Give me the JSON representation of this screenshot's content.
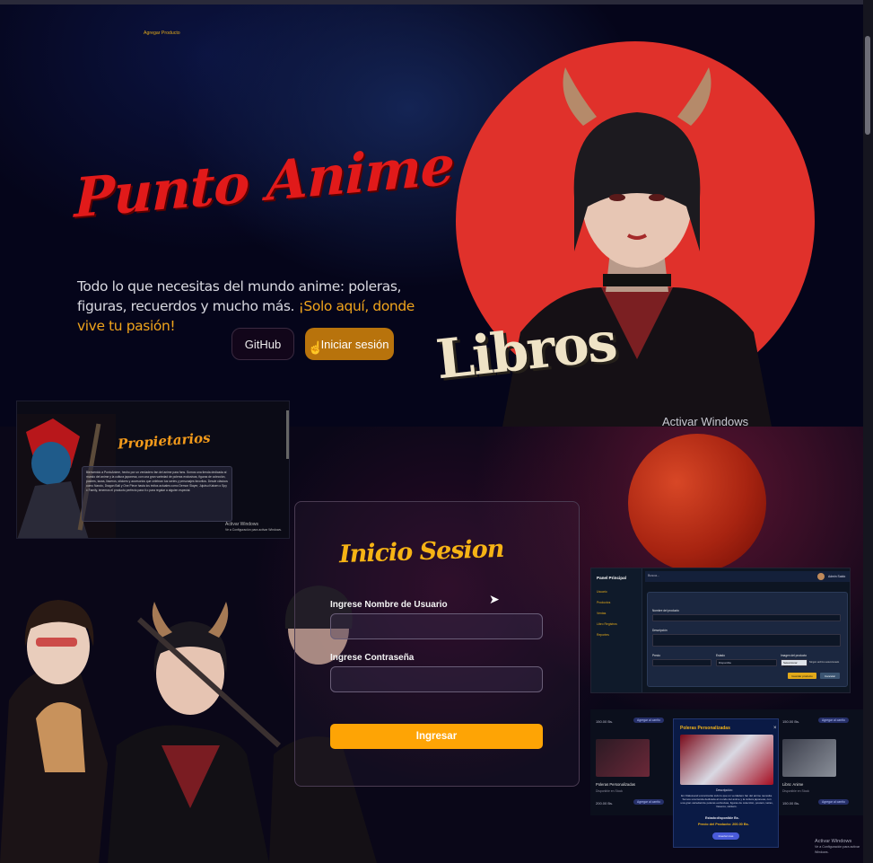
{
  "hero": {
    "logo_text": "Punto Anime",
    "tagline_main": "Todo lo que necesitas del mundo anime: poleras, figuras, recuerdos y mucho más. ",
    "tagline_highlight": "¡Solo aquí, donde vive tu pasión!",
    "github_label": "GitHub",
    "login_label": "Iniciar sesión",
    "stamp_text": "Libros",
    "activate_windows": "Activar Windows"
  },
  "propietarios": {
    "title": "Propietarios",
    "body": "Bienvenido a PuntoAnime, hecho por un verdadero fan del anime para fans. Somos una tienda dedicada al mundo del anime y la cultura japonesa, con una gran variedad de poleras exclusivas, figuras de colección, posters, tazas, llaveros, stickers y accesorios que celebran tus series y personajes favoritos. Desde clásicos como Naruto, Dragon Ball y One Piece hasta los éxitos actuales como Demon Slayer, Jujutsu Kaisen o Spy x Family, tenemos el producto perfecto para ti o para regalar a alguien especial.",
    "activate_line1": "Activar Windows",
    "activate_line2": "Ve a Configuración para activar Windows."
  },
  "login": {
    "title": "Inicio Sesion",
    "username_label": "Ingrese Nombre de Usuario",
    "username_value": "",
    "password_label": "Ingrese Contraseña",
    "password_value": "",
    "submit_label": "Ingresar"
  },
  "admin": {
    "side_title": "Panel Principal",
    "side_items": [
      "Usuario",
      "Productos",
      "Ventas",
      "Libro Registros",
      "Reportes"
    ],
    "search_text": "Busca...",
    "user_name": "Admin Saido",
    "form_title": "Agregar Producto",
    "name_label": "Nombre del producto",
    "desc_label": "Descripción",
    "price_label": "Precio",
    "state_label": "Estado",
    "state_value": "Disponible",
    "image_label": "Imagen del producto",
    "file_button": "Seleccionar archivo",
    "file_status": "Ningún archivo seleccionado",
    "add_button": "Guardar producto",
    "cancel_button": "Cancelar"
  },
  "shop": {
    "items": [
      {
        "name": "",
        "availability": "Disponible en Stock",
        "price": "150.00 Bs.",
        "cart": "Agregar al carrito"
      },
      {
        "name": "Poleras Personalizadas",
        "availability": "Disponible en Stock",
        "price": "200.00 Bs.",
        "cart": "Agregar al carrito"
      },
      {
        "name": "Libro: Anime",
        "availability": "Disponible en Stock",
        "price": "150.00 Bs.",
        "cart": "Agregar al carrito"
      }
    ]
  },
  "modal": {
    "title": "Poleras Personalizadas",
    "close": "×",
    "desc_label": "Descripción:",
    "description": "En OtakuLand encontrarás todo lo que un verdadero fan del anime necesita. Somos una tienda dedicada al mundo del anime y la cultura japonesa, con una gran variedad de poleras exclusivas, figuras de colección, posters, tazas, llaveros, stickers.",
    "state": "Estado:disponible Bs.",
    "price": "Precio del Producto: 200.00 Bs.",
    "button": "Insertar mas"
  },
  "desktop": {
    "activate_line1": "Activar Windows",
    "activate_line2": "Ve a Configuración para activar Windows."
  },
  "colors": {
    "hero_red_circle": "#e0312b",
    "logo_red": "#e11a1a",
    "accent_orange": "#fea405",
    "login_button": "#b8730c",
    "shop_accent": "#f2b319"
  }
}
